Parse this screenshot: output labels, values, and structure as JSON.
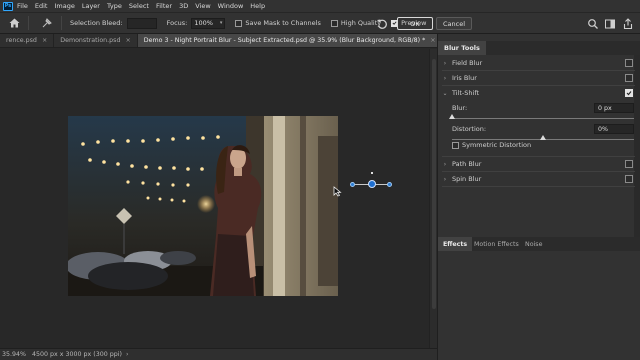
{
  "app": {
    "logo": "Ps",
    "menu": [
      "File",
      "Edit",
      "Image",
      "Layer",
      "Type",
      "Select",
      "Filter",
      "3D",
      "View",
      "Window",
      "Help"
    ]
  },
  "options": {
    "selection_bleed_label": "Selection Bleed:",
    "focus_label": "Focus:",
    "focus_value": "100%",
    "save_mask_label": "Save Mask to Channels",
    "save_mask_checked": false,
    "high_quality_label": "High Quality",
    "high_quality_checked": false,
    "preview_label": "Preview",
    "preview_checked": true,
    "ok_label": "OK",
    "cancel_label": "Cancel"
  },
  "tabs": [
    {
      "label": "rence.psd",
      "close": "×",
      "active": false
    },
    {
      "label": "Demonstration.psd",
      "close": "×",
      "active": false
    },
    {
      "label": "Demo 3 - Night Portrait Blur - Subject Extracted.psd @ 35.9% (Blur Background, RGB/8) *",
      "close": "×",
      "active": true
    }
  ],
  "status": {
    "zoom": "35.94%",
    "doc_info": "4500 px x 3000 px (300 ppi)",
    "chevron": "›"
  },
  "panel": {
    "title": "Blur Tools",
    "items": [
      {
        "label": "Field Blur",
        "expanded": false,
        "checked": false
      },
      {
        "label": "Iris Blur",
        "expanded": false,
        "checked": false
      },
      {
        "label": "Tilt-Shift",
        "expanded": true,
        "checked": true
      },
      {
        "label": "Path Blur",
        "expanded": false,
        "checked": false
      },
      {
        "label": "Spin Blur",
        "expanded": false,
        "checked": false
      }
    ],
    "blur_label": "Blur:",
    "blur_value": "0 px",
    "blur_level": 0,
    "distortion_label": "Distortion:",
    "distortion_value": "0%",
    "distortion_level": 0.5,
    "symmetric_label": "Symmetric Distortion",
    "symmetric_checked": false,
    "bottom_tabs": [
      "Effects",
      "Motion Effects",
      "Noise"
    ]
  },
  "colors": {
    "accent": "#31a8ff",
    "pin": "#2b7cd3"
  },
  "icons": {
    "home": "home-icon",
    "tool": "blur-pin-tool-icon",
    "reset": "reset-icon",
    "search": "search-icon",
    "workspace": "workspace-icon",
    "share": "share-icon"
  }
}
